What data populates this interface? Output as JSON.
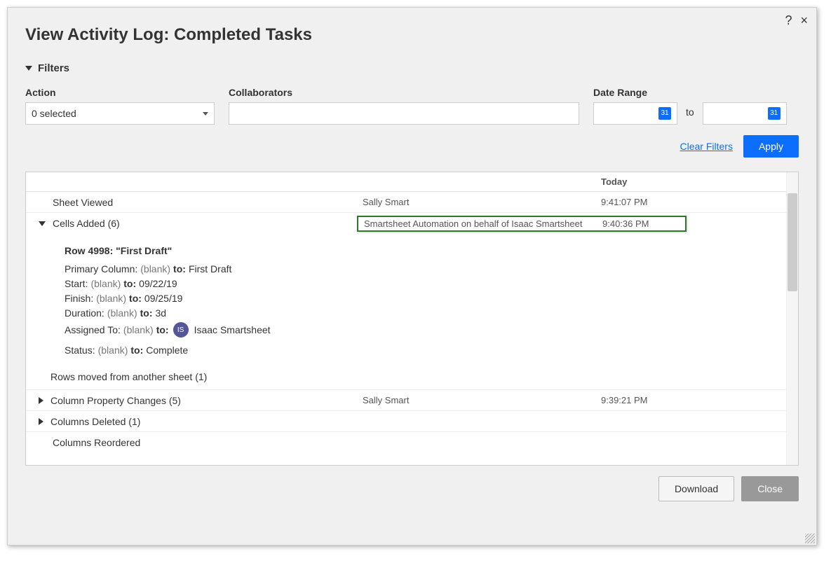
{
  "dialog": {
    "title": "View Activity Log: Completed Tasks",
    "help": "?",
    "close": "×"
  },
  "filters": {
    "label": "Filters",
    "action": {
      "label": "Action",
      "selected": "0 selected"
    },
    "collaborators": {
      "label": "Collaborators",
      "value": ""
    },
    "dateRange": {
      "label": "Date Range",
      "to": "to",
      "calendarIcon": "31"
    },
    "clear": "Clear Filters",
    "apply": "Apply"
  },
  "log": {
    "dateHeader": "Today",
    "rows": [
      {
        "action": "Sheet Viewed",
        "collab": "Sally Smart",
        "time": "9:41:07 PM",
        "expandable": false
      },
      {
        "action": "Cells Added (6)",
        "collab": "Smartsheet Automation on behalf of Isaac Smartsheet",
        "time": "9:40:36 PM",
        "expandable": true,
        "expanded": true,
        "highlighted": true
      },
      {
        "action": "Column Property Changes (5)",
        "collab": "Sally Smart",
        "time": "9:39:21 PM",
        "expandable": true,
        "expanded": false
      },
      {
        "action": "Columns Deleted (1)",
        "collab": "",
        "time": "",
        "expandable": true,
        "expanded": false
      },
      {
        "action": "Columns Reordered",
        "collab": "",
        "time": "",
        "expandable": false
      }
    ],
    "details": {
      "title": "Row 4998: \"First Draft\"",
      "changes": [
        {
          "field": "Primary Column:",
          "from": "(blank)",
          "to": "First Draft"
        },
        {
          "field": "Start:",
          "from": "(blank)",
          "to": "09/22/19"
        },
        {
          "field": "Finish:",
          "from": "(blank)",
          "to": "09/25/19"
        },
        {
          "field": "Duration:",
          "from": "(blank)",
          "to": "3d"
        },
        {
          "field": "Assigned To:",
          "from": "(blank)",
          "to": "Isaac Smartsheet",
          "avatar": "IS"
        },
        {
          "field": "Status:",
          "from": "(blank)",
          "to": "Complete"
        }
      ],
      "subline": "Rows moved from another sheet (1)",
      "toLabel": "to:"
    }
  },
  "footer": {
    "download": "Download",
    "close": "Close"
  }
}
